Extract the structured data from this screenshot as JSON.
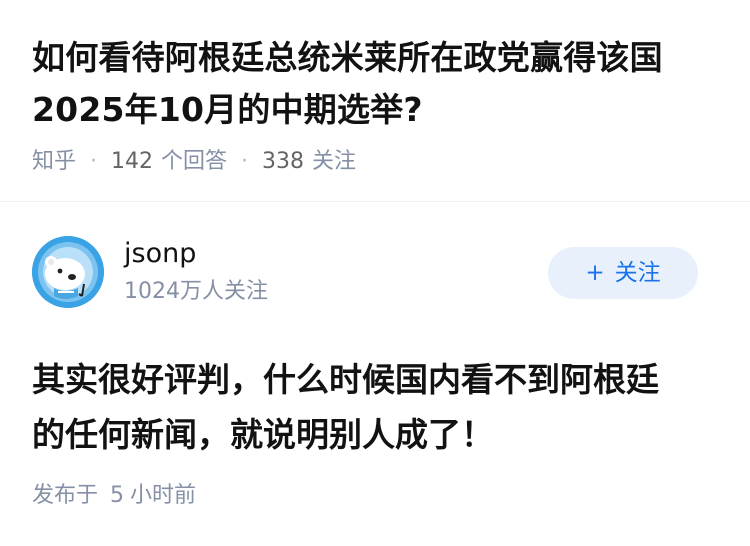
{
  "question": {
    "title": "如何看待阿根廷总统米莱所在政党赢得该国\n2025年10月的中期选举?",
    "source": "知乎",
    "answers_count": "142",
    "answers_label": "个回答",
    "followers_count": "338",
    "followers_label": "关注"
  },
  "author": {
    "name": "jsonp",
    "followers": "1024万人关注",
    "avatar_icon": "polar-bear-avatar",
    "follow_button": {
      "plus": "+",
      "label": "关注"
    }
  },
  "answer": {
    "text": "其实很好评判，什么时候国内看不到阿根廷\n的任何新闻，就说明别人成了！",
    "published_label": "发布于",
    "published_num": "5",
    "published_unit": "小时前"
  },
  "colors": {
    "meta_gray": "#8590a6",
    "follow_blue": "#1a73e8",
    "follow_bg": "#e8f1fb",
    "avatar_blue": "#3aa3e6"
  }
}
